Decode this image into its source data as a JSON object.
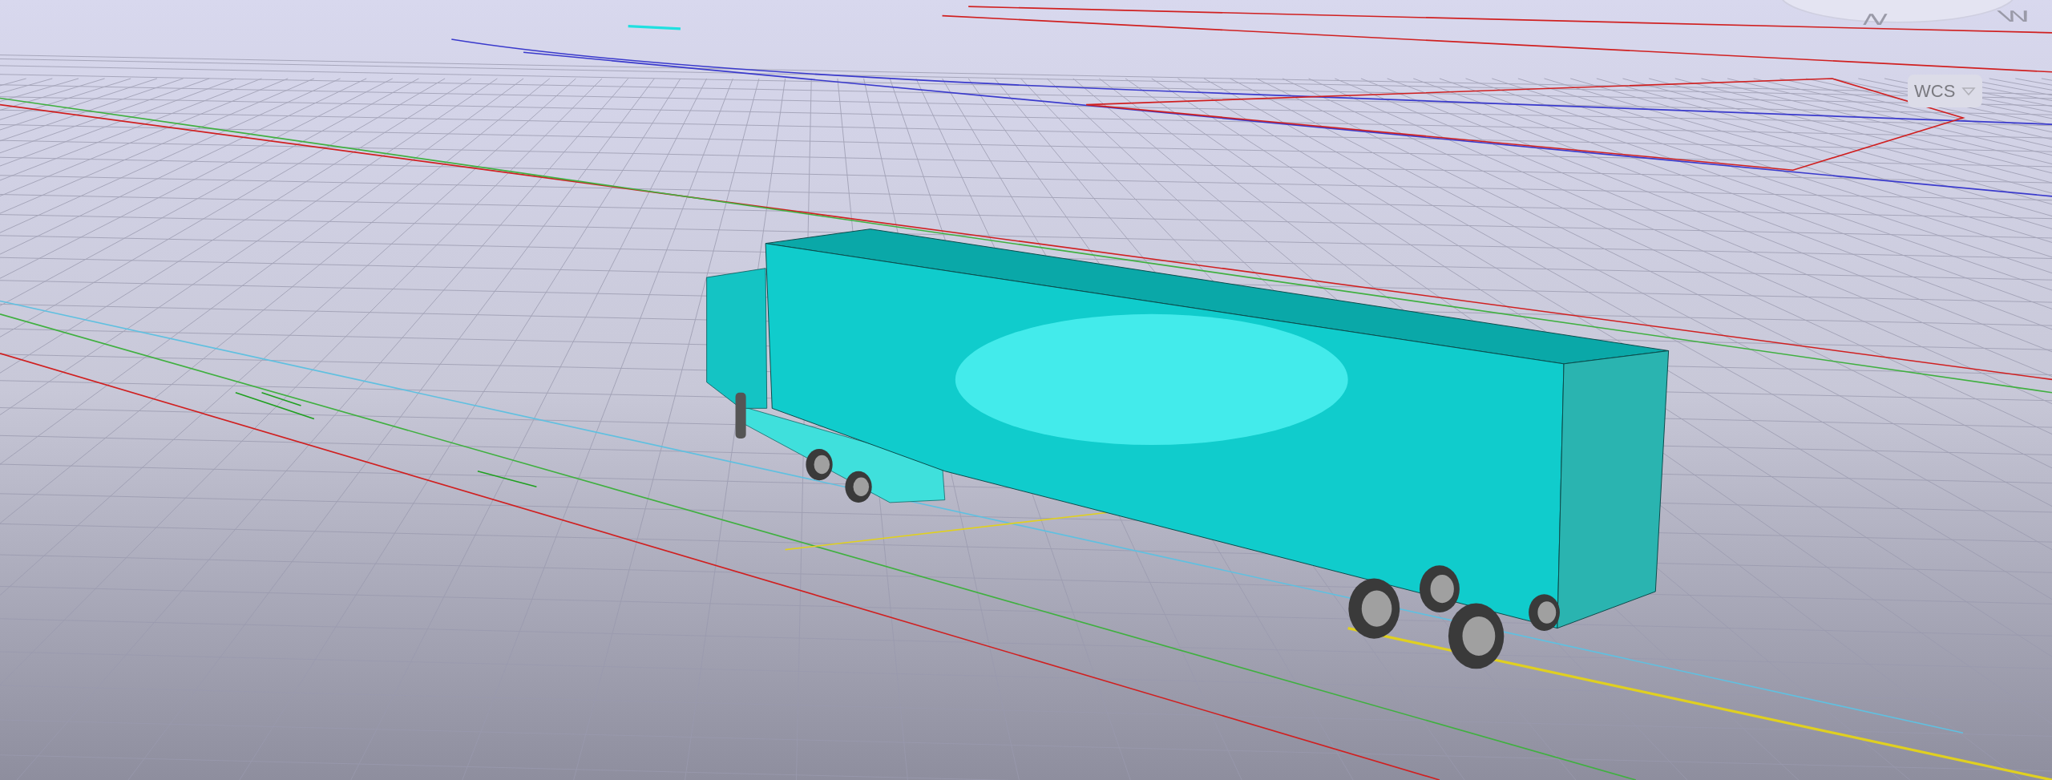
{
  "viewcube": {
    "compass_labels": [
      "N",
      "W"
    ]
  },
  "coordinate_system": {
    "label": "WCS"
  }
}
